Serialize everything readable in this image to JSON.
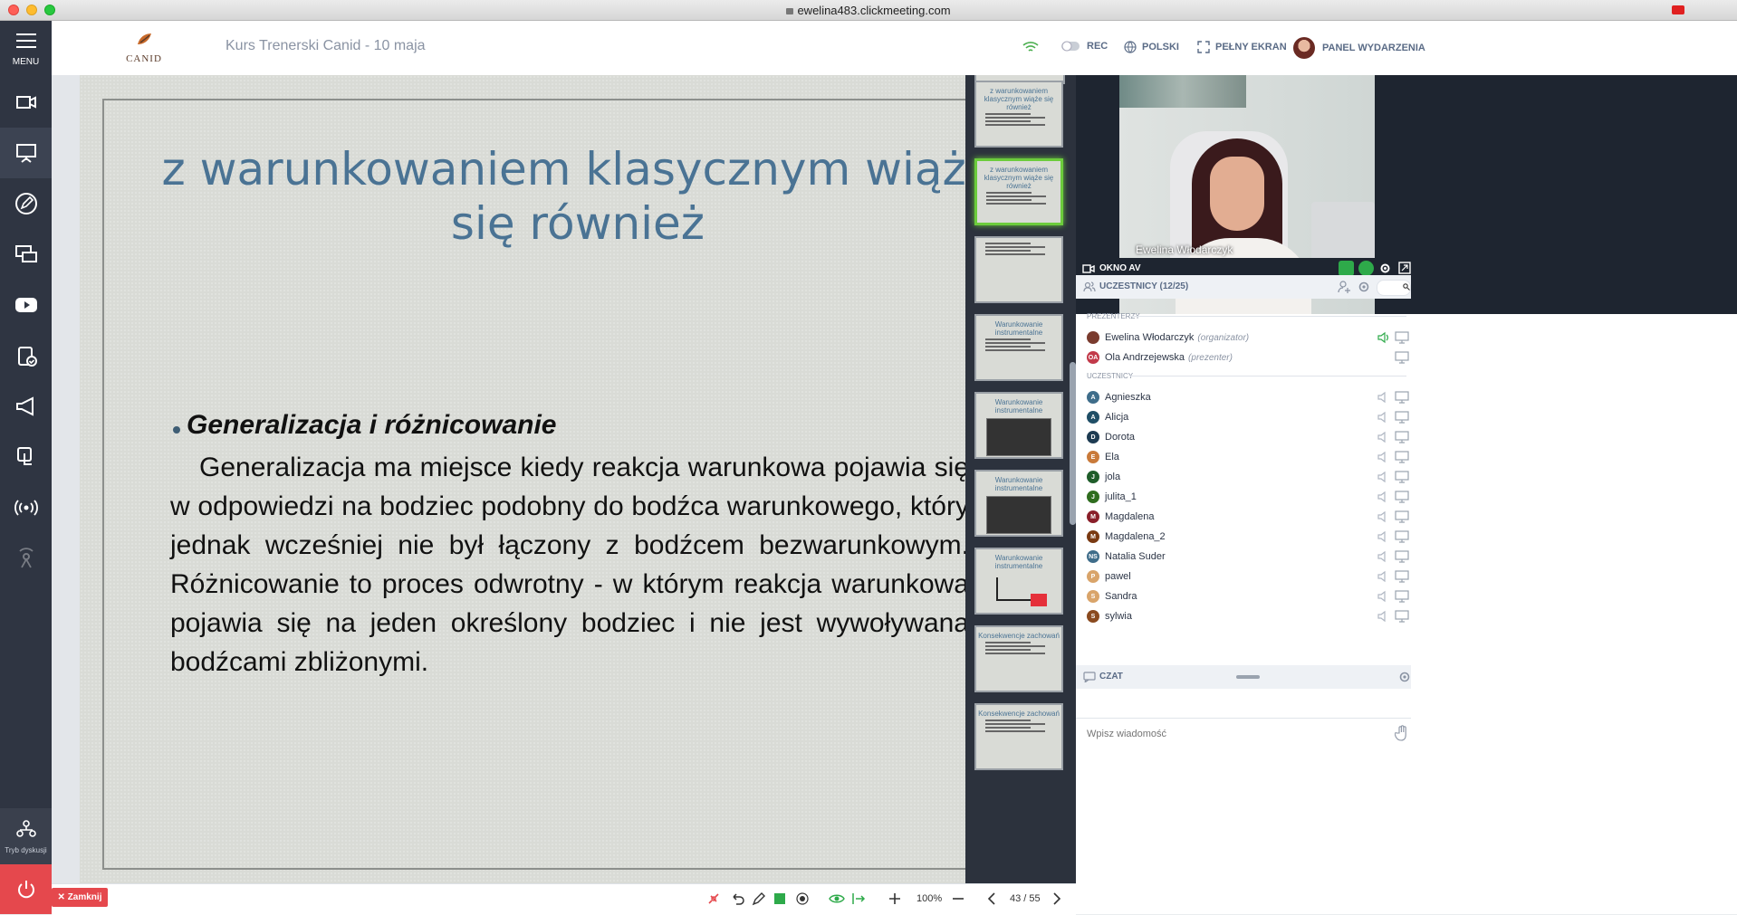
{
  "browser": {
    "url": "ewelina483.clickmeeting.com"
  },
  "rail": {
    "menu_label": "MENU",
    "discussion_label": "Tryb dyskusji"
  },
  "header": {
    "logo_text": "CANID",
    "meeting_title": "Kurs Trenerski Canid - 10 maja",
    "rec_label": "REC",
    "language_label": "POLSKI",
    "fullscreen_label": "PEŁNY EKRAN",
    "event_panel_label": "PANEL WYDARZENIA"
  },
  "slide": {
    "title_line1": "z warunkowaniem klasycznym wiąże",
    "title_line2": "się również",
    "bullet_heading": "Generalizacja i różnicowanie",
    "body": "Generalizacja ma miejsce kiedy reakcja warunkowa pojawia się w odpowiedzi na bodziec podobny do bodźca warunkowego, który jednak wcześniej nie był łączony z bodźcem bezwarunkowym. Różnicowanie to proces odwrotny - w którym reakcja warunkowa pojawia się na jeden określony bodziec i nie jest wywoływana bodźcami zbliżonymi."
  },
  "thumbnails": [
    {
      "title": "z warunkowaniem klasycznym wiąże się również",
      "kind": "text"
    },
    {
      "title": "z warunkowaniem klasycznym wiąże się również",
      "kind": "text",
      "active": true
    },
    {
      "title": "",
      "kind": "text"
    },
    {
      "title": "Warunkowanie instrumentalne",
      "kind": "text"
    },
    {
      "title": "Warunkowanie instrumentalne",
      "kind": "image"
    },
    {
      "title": "Warunkowanie instrumentalne",
      "kind": "image"
    },
    {
      "title": "Warunkowanie instrumentalne",
      "kind": "diagram"
    },
    {
      "title": "Konsekwencje zachowań",
      "kind": "text"
    },
    {
      "title": "Konsekwencje zachowań",
      "kind": "text"
    }
  ],
  "video": {
    "presenter_name": "Ewelina Włodarczyk",
    "window_label": "OKNO AV"
  },
  "participants": {
    "section_label": "UCZESTNICY (12/25)",
    "presenters_label": "PREZENTERZY",
    "attendees_label": "UCZESTNICY",
    "presenters": [
      {
        "name": "Ewelina Włodarczyk",
        "role": "(organizator)",
        "initials": "",
        "color": "#7a3b2e"
      },
      {
        "name": "Ola Andrzejewska",
        "role": "(prezenter)",
        "initials": "OA",
        "color": "#c23a4a"
      }
    ],
    "attendees": [
      {
        "name": "Agnieszka",
        "initials": "A",
        "color": "#3f6d8a"
      },
      {
        "name": "Alicja",
        "initials": "A",
        "color": "#1f4e66"
      },
      {
        "name": "Dorota",
        "initials": "D",
        "color": "#1d3b52"
      },
      {
        "name": "Ela",
        "initials": "E",
        "color": "#c97a3a"
      },
      {
        "name": "jola",
        "initials": "J",
        "color": "#1f5d2a"
      },
      {
        "name": "julita_1",
        "initials": "J",
        "color": "#2f6d1f"
      },
      {
        "name": "Magdalena",
        "initials": "M",
        "color": "#8a1f2a"
      },
      {
        "name": "Magdalena_2",
        "initials": "M",
        "color": "#7a3a12"
      },
      {
        "name": "Natalia Suder",
        "initials": "NS",
        "color": "#3f6d8a"
      },
      {
        "name": "pawel",
        "initials": "P",
        "color": "#d9a46a"
      },
      {
        "name": "Sandra",
        "initials": "S",
        "color": "#d9a46a"
      },
      {
        "name": "sylwia",
        "initials": "S",
        "color": "#8a4a1f"
      }
    ]
  },
  "chat": {
    "label": "CZAT",
    "placeholder": "Wpisz wiadomość"
  },
  "toolbar": {
    "close_label": "Zamknij",
    "zoom": "100%",
    "pages": "43 / 55"
  },
  "colors": {
    "accent_green": "#2eaa4a",
    "close_red": "#e5484d",
    "rail_bg": "#2f3542",
    "slide_title": "#4a7394"
  }
}
